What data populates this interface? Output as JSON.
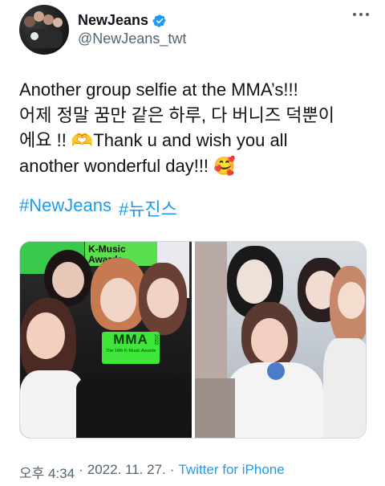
{
  "author": {
    "display_name": "NewJeans",
    "handle": "@NewJeans_twt",
    "verified": true,
    "avatar_icon": "group-photo-avatar"
  },
  "tweet": {
    "text": "Another group selfie at the MMA’s!!!\n어제 정말 꿈만 같은 하루, 다 버니즈 덕뿐이\n에요 !! 🫶Thank u and wish you all\nanother wonderful day!!! 🥰",
    "hashtags": [
      "#NewJeans",
      "#뉴진스"
    ]
  },
  "media": {
    "left_photo": {
      "banner_text": "MMA",
      "banner_sub": "The 14th K-Music Awards",
      "banner_year": "2022",
      "backdrop_text": "K-Music\nAwards"
    },
    "right_photo": {}
  },
  "meta": {
    "time": "오후 4:34",
    "separator": "·",
    "date": "2022. 11. 27.",
    "client": "Twitter for iPhone"
  },
  "colors": {
    "link": "#1d9bf0",
    "secondary": "#536471",
    "text": "#0f1419",
    "mma_green": "#3ee63a"
  }
}
